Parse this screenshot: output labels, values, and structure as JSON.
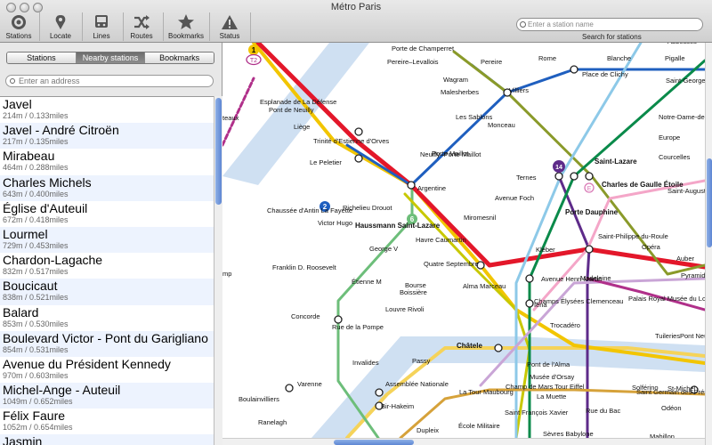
{
  "window": {
    "title": "Métro Paris"
  },
  "toolbar": {
    "items": [
      {
        "label": "Stations",
        "icon": "stations-icon"
      },
      {
        "label": "Locate",
        "icon": "locate-pin-icon"
      },
      {
        "label": "Lines",
        "icon": "lines-icon"
      },
      {
        "label": "Routes",
        "icon": "routes-shuffle-icon"
      },
      {
        "label": "Bookmarks",
        "icon": "star-icon"
      },
      {
        "label": "Status",
        "icon": "warning-icon"
      }
    ],
    "search": {
      "placeholder": "Enter a station name",
      "caption": "Search for stations"
    }
  },
  "sidebar": {
    "tabs": [
      {
        "label": "Stations",
        "active": false
      },
      {
        "label": "Nearby stations",
        "active": true
      },
      {
        "label": "Bookmarks",
        "active": false
      }
    ],
    "address_placeholder": "Enter an address",
    "stations": [
      {
        "name": "Javel",
        "distance": "214m / 0.133miles"
      },
      {
        "name": "Javel - André Citroën",
        "distance": "217m / 0.135miles"
      },
      {
        "name": "Mirabeau",
        "distance": "464m / 0.288miles"
      },
      {
        "name": "Charles Michels",
        "distance": "643m / 0.400miles"
      },
      {
        "name": "Église d'Auteuil",
        "distance": "672m / 0.418miles"
      },
      {
        "name": "Lourmel",
        "distance": "729m / 0.453miles"
      },
      {
        "name": "Chardon-Lagache",
        "distance": "832m / 0.517miles"
      },
      {
        "name": "Boucicaut",
        "distance": "838m / 0.521miles"
      },
      {
        "name": "Balard",
        "distance": "853m / 0.530miles"
      },
      {
        "name": "Boulevard Victor - Pont du Garigliano",
        "distance": "854m / 0.531miles"
      },
      {
        "name": "Avenue du Président Kennedy",
        "distance": "970m / 0.603miles"
      },
      {
        "name": "Michel-Ange - Auteuil",
        "distance": "1049m / 0.652miles"
      },
      {
        "name": "Félix Faure",
        "distance": "1052m / 0.654miles"
      },
      {
        "name": "Jasmin",
        "distance": ""
      }
    ]
  },
  "map": {
    "line_colors": {
      "line1": "#f2c500",
      "line2": "#1f5fbf",
      "line3": "#8a9a2a",
      "line6": "#6dbe7a",
      "line7": "#f4a6c8",
      "line8": "#c9a5d6",
      "line9": "#c8c800",
      "line10": "#d6a23a",
      "line12": "#0a8a4a",
      "line13": "#8dc9e8",
      "line14": "#5e2b8a",
      "rer_a": "#e3172a",
      "rer_c": "#f5d35a",
      "line4": "#b0308a",
      "line5": "#f08c3a"
    },
    "line_badges": [
      {
        "text": "1"
      },
      {
        "text": "T2"
      },
      {
        "text": "2"
      },
      {
        "text": "6"
      },
      {
        "text": "14"
      },
      {
        "text": "E"
      }
    ],
    "labels": [
      "Abbesses",
      "Porte de Champerret",
      "Pereire–Levallois",
      "Pereire",
      "Rome",
      "Blanche",
      "Pigalle",
      "Esplanade de La Défense",
      "Wagram",
      "Place de Clichy",
      "Saint-Georges",
      "Malesherbes",
      "Villiers",
      "Notre-Dame-de-Lorette",
      "Pont de Neuilly",
      "Liège",
      "Les Sablons",
      "Monceau",
      "Europe",
      "Trinité d'Estienne d'Orves",
      "Porte Maillot",
      "Courcelles",
      "Le Peletier",
      "Neuilly–Porte Maillot",
      "Ternes",
      "Saint-Lazare",
      "Haussmann Saint-Lazare",
      "Argentine",
      "Charles de Gaulle Étoile",
      "Saint-Augustin",
      "Chaussée d'Antin La Fayette",
      "Richelieu Drouot",
      "Avenue Foch",
      "Victor Hugo",
      "Miromesnil",
      "Porte Dauphine",
      "Saint-Philippe du-Roule",
      "Havre Caumartin",
      "Opéra",
      "George V",
      "Quatre Septembre",
      "Kléber",
      "Auber",
      "Bourse",
      "Franklin D. Roosevelt",
      "Avenue Henri Martin",
      "Madeleine",
      "Pyramides",
      "Étienne M",
      "Boissière",
      "Alma Marceau",
      "Champs Élysées Clemenceau",
      "Palais Royal Musée du Louvre",
      "Louvre Rivoli",
      "Iéna",
      "Concorde",
      "Rue de la Pompe",
      "Trocadéro",
      "Tuileries",
      "Pont Neuf",
      "Châtele",
      "Invalides",
      "Passy",
      "Pont de l'Alma",
      "Musée d'Orsay",
      "Assemblée Nationale",
      "Champ de Mars Tour Eiffel",
      "Varenne",
      "La Muette",
      "Solférino",
      "Saint Germain des-Prés",
      "St-Michel",
      "Bir-Hakeim",
      "La Tour Maubourg",
      "Saint François Xavier",
      "Rue du Bac",
      "Odéon",
      "Boulainvilliers",
      "Ranelagh",
      "Dupleix",
      "École Militaire",
      "Sèvres Babylone",
      "Mabillon",
      "teaux",
      "mp"
    ]
  }
}
